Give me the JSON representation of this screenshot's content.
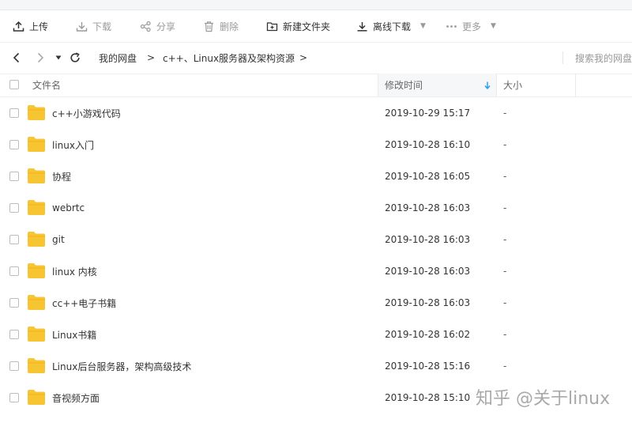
{
  "toolbar": {
    "upload": "上传",
    "download": "下载",
    "share": "分享",
    "delete": "删除",
    "new_folder": "新建文件夹",
    "offline_download": "离线下载",
    "more": "更多"
  },
  "nav": {
    "breadcrumbs": [
      "我的网盘",
      "c++、Linux服务器及架构资源"
    ],
    "separator": ">",
    "search_placeholder": "搜索我的网盘"
  },
  "table": {
    "headers": {
      "name": "文件名",
      "modified": "修改时间",
      "size": "大小"
    },
    "sort_column": "modified",
    "sort_direction": "descending",
    "rows": [
      {
        "name": "c++小游戏代码",
        "modified": "2019-10-29 15:17",
        "size": "-"
      },
      {
        "name": "linux入门",
        "modified": "2019-10-28 16:10",
        "size": "-"
      },
      {
        "name": "协程",
        "modified": "2019-10-28 16:05",
        "size": "-"
      },
      {
        "name": "webrtc",
        "modified": "2019-10-28 16:03",
        "size": "-"
      },
      {
        "name": "git",
        "modified": "2019-10-28 16:03",
        "size": "-"
      },
      {
        "name": "linux 内核",
        "modified": "2019-10-28 16:03",
        "size": "-"
      },
      {
        "name": "cc++电子书籍",
        "modified": "2019-10-28 16:03",
        "size": "-"
      },
      {
        "name": "Linux书籍",
        "modified": "2019-10-28 16:02",
        "size": "-"
      },
      {
        "name": "Linux后台服务器，架构高级技术",
        "modified": "2019-10-28 15:16",
        "size": "-"
      },
      {
        "name": "音视频方面",
        "modified": "2019-10-28 15:10",
        "size": "-"
      }
    ]
  },
  "watermark": "知乎 @关于linux",
  "colors": {
    "folder": "#f7c531",
    "sort_arrow": "#2aa0ea"
  },
  "icons": {
    "upload": "upload-icon",
    "download": "download-icon",
    "share": "share-icon",
    "delete": "trash-icon",
    "new_folder": "new-folder-icon",
    "offline_download": "offline-download-icon",
    "more": "more-dots-icon",
    "folder": "folder-icon"
  }
}
